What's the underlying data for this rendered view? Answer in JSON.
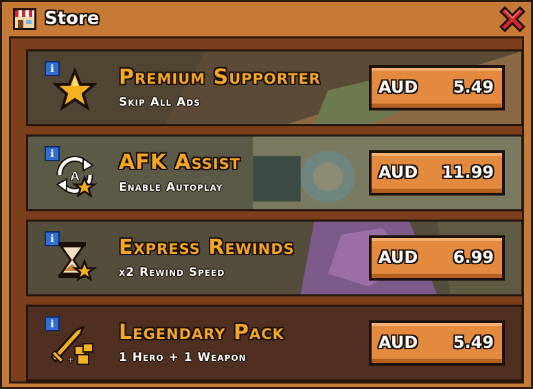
{
  "window": {
    "title": "Store",
    "icon": "store-awning-icon",
    "close_icon": "close-x-icon"
  },
  "colors": {
    "frame": "#c77a35",
    "panel": "#7b3f1c",
    "title_gold": "#f5a623",
    "button": "#e38a3e",
    "info_blue": "#2f6fd3",
    "close_red": "#d8262e"
  },
  "items": [
    {
      "name": "Premium Supporter",
      "description": "Skip All Ads",
      "currency": "AUD",
      "price": "5.49",
      "icon": "star-icon",
      "info": "i"
    },
    {
      "name": "AFK Assist",
      "description": "Enable Autoplay",
      "currency": "AUD",
      "price": "11.99",
      "icon": "autoplay-star-icon",
      "info": "i"
    },
    {
      "name": "Express Rewinds",
      "description": "x2 Rewind Speed",
      "currency": "AUD",
      "price": "6.99",
      "icon": "hourglass-star-icon",
      "info": "i"
    },
    {
      "name": "Legendary Pack",
      "description": "1 Hero + 1 Weapon",
      "currency": "AUD",
      "price": "5.49",
      "icon": "sword-heroes-icon",
      "info": "i"
    }
  ]
}
